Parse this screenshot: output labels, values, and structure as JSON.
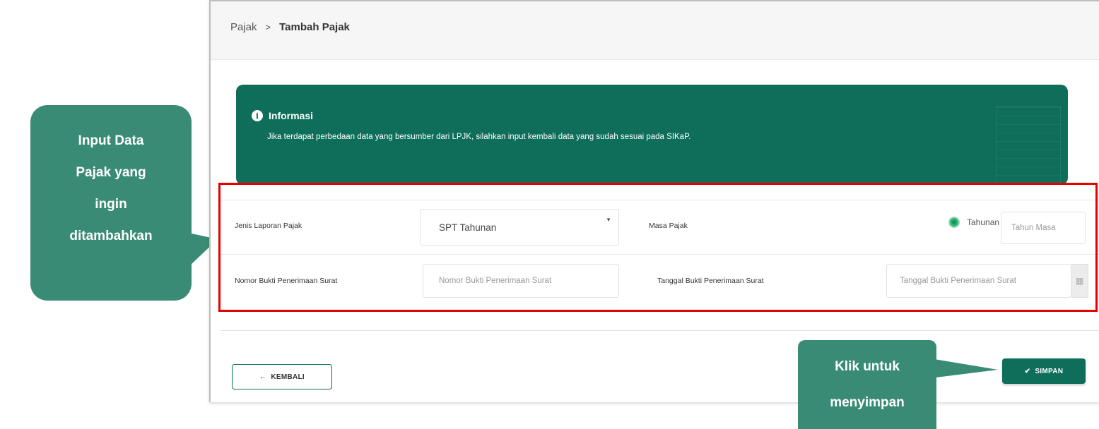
{
  "breadcrumb": {
    "root": "Pajak",
    "separator": ">",
    "current": "Tambah Pajak"
  },
  "info": {
    "title": "Informasi",
    "text": "Jika terdapat perbedaan data yang bersumber dari LPJK, silahkan input kembali data yang sudah sesuai pada SIKaP."
  },
  "form": {
    "jenis_label": "Jenis Laporan Pajak",
    "jenis_value": "SPT Tahunan",
    "masa_label": "Masa Pajak",
    "masa_option": "Tahunan",
    "tahun_masa_placeholder": "Tahun Masa",
    "nomor_label": "Nomor Bukti Penerimaan Surat",
    "nomor_placeholder": "Nomor Bukti Penerimaan Surat",
    "tanggal_label": "Tanggal Bukti Penerimaan Surat",
    "tanggal_placeholder": "Tanggal Bukti Penerimaan Surat"
  },
  "buttons": {
    "back_label": "KEMBALI",
    "save_label": "SIMPAN"
  },
  "callouts": {
    "left": [
      "Input Data",
      "Pajak yang",
      "ingin",
      "ditambahkan"
    ],
    "right": [
      "Klik untuk",
      "menyimpan"
    ]
  },
  "colors": {
    "primary": "#0e6e5a",
    "callout": "#3a8b76",
    "highlight": "#e60000"
  }
}
